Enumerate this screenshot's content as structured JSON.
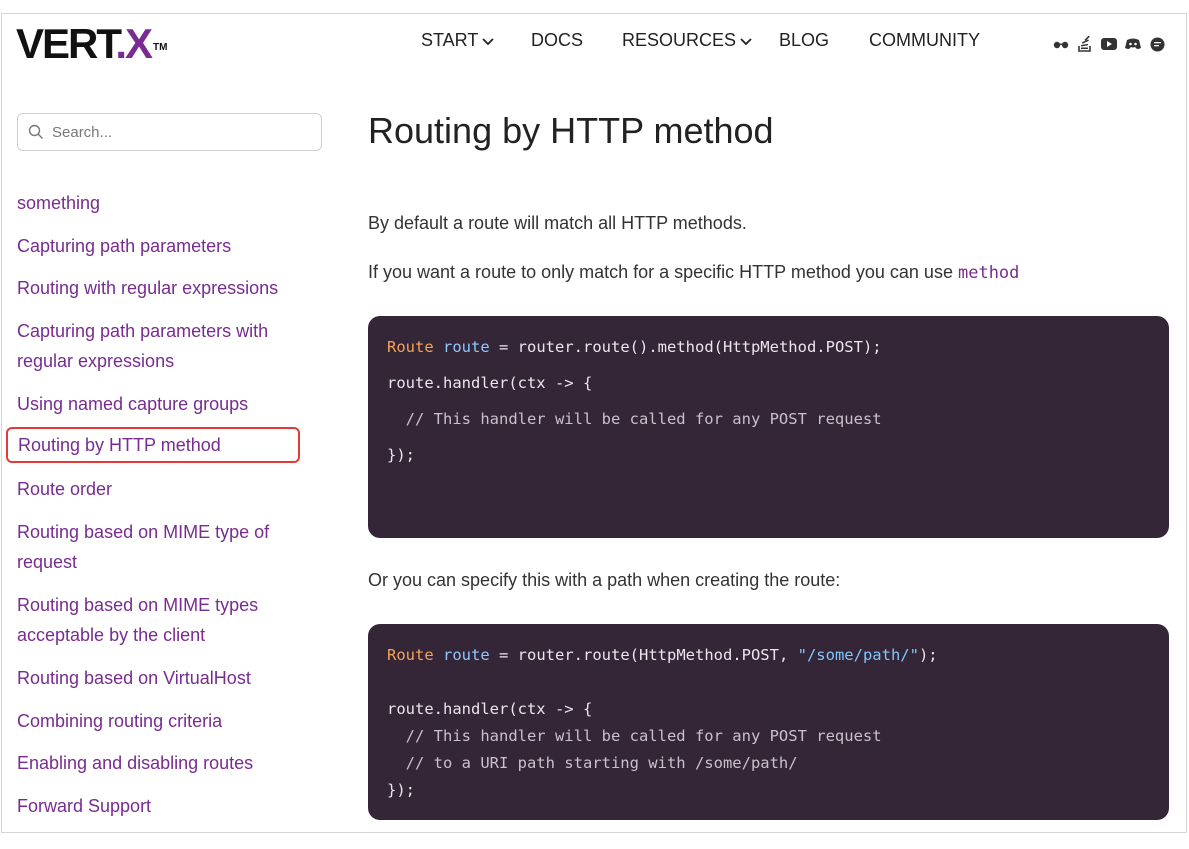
{
  "header": {
    "logo": {
      "brand": "VERT",
      "dot": ".",
      "x": "X",
      "tm": "TM"
    },
    "nav": [
      {
        "label": "START",
        "dropdown": true
      },
      {
        "label": "DOCS",
        "dropdown": false
      },
      {
        "label": "RESOURCES",
        "dropdown": true
      },
      {
        "label": "BLOG",
        "dropdown": false
      },
      {
        "label": "COMMUNITY",
        "dropdown": false
      }
    ],
    "social_icons": [
      "glasses-icon",
      "stackoverflow-icon",
      "youtube-icon",
      "discord-icon",
      "chat-icon"
    ]
  },
  "sidebar": {
    "search_placeholder": "Search...",
    "items": [
      {
        "label": "something"
      },
      {
        "label": "Capturing path parameters"
      },
      {
        "label": "Routing with regular expressions"
      },
      {
        "label": "Capturing path parameters with regular expressions"
      },
      {
        "label": "Using named capture groups"
      },
      {
        "label": "Routing by HTTP method",
        "highlighted": true
      },
      {
        "label": "Route order"
      },
      {
        "label": "Routing based on MIME type of request"
      },
      {
        "label": "Routing based on MIME types acceptable by the client"
      },
      {
        "label": "Routing based on VirtualHost"
      },
      {
        "label": "Combining routing criteria"
      },
      {
        "label": "Enabling and disabling routes"
      },
      {
        "label": "Forward Support"
      }
    ]
  },
  "main": {
    "title": "Routing by HTTP method",
    "para1": "By default a route will match all HTTP methods.",
    "para2": "If you want a route to only match for a specific HTTP method you can use",
    "para2_code": "method",
    "para3": "Or you can specify this with a path when creating the route:",
    "code1": {
      "l1_kw": "Route",
      "l1_var": "route",
      "l1_rest": " = router.route().method(HttpMethod.POST);",
      "l2": "route.handler(ctx -> {",
      "l3": "  // This handler will be called for any POST request",
      "l4": "});"
    },
    "code2": {
      "l1_kw": "Route",
      "l1_var": "route",
      "l1_rest": " = router.route(HttpMethod.POST, ",
      "l1_str": "\"/some/path/\"",
      "l1_end": ");",
      "l2": "route.handler(ctx -> {",
      "l3": "  // This handler will be called for any POST request",
      "l4": "  // to a URI path starting with /some/path/",
      "l5": "});"
    }
  },
  "colors": {
    "accent": "#782b90",
    "code_bg": "#342537",
    "highlight_border": "#e53935"
  }
}
